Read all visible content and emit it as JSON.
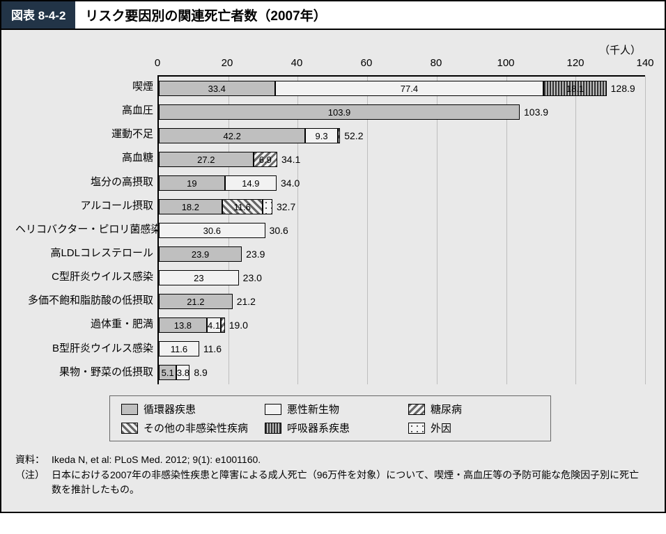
{
  "header": {
    "fig_no": "図表 8-4-2",
    "title": "リスク要因別の関連死亡者数（2007年）"
  },
  "unit_label": "（千人）",
  "source_label": "資料：",
  "source_text": "Ikeda N, et al: PLoS Med. 2012; 9(1): e1001160.",
  "note_label": "（注）",
  "note_text": "日本における2007年の非感染性疾患と障害による成人死亡（96万件を対象）について、喫煙・高血圧等の予防可能な危険因子別に死亡数を推計したもの。",
  "legend": {
    "cardio": "循環器疾患",
    "cancer": "悪性新生物",
    "diabetes": "糖尿病",
    "ncd": "その他の非感染性疾病",
    "resp": "呼吸器系疾患",
    "ext": "外因"
  },
  "chart_data": {
    "type": "bar",
    "orientation": "horizontal",
    "stacked": true,
    "xlabel": "",
    "ylabel": "",
    "xlim": [
      0,
      140
    ],
    "xticks": [
      0,
      20,
      40,
      60,
      80,
      100,
      120,
      140
    ],
    "series_labels": {
      "cardio": "循環器疾患",
      "cancer": "悪性新生物",
      "diabetes": "糖尿病",
      "ncd": "その他の非感染性疾病",
      "resp": "呼吸器系疾患",
      "ext": "外因"
    },
    "rows": [
      {
        "label": "喫煙",
        "segments": [
          {
            "k": "cardio",
            "v": 33.4
          },
          {
            "k": "cancer",
            "v": 77.4
          },
          {
            "k": "resp",
            "v": 18.1
          }
        ],
        "total": 128.9
      },
      {
        "label": "高血圧",
        "segments": [
          {
            "k": "cardio",
            "v": 103.9
          }
        ],
        "total": 103.9
      },
      {
        "label": "運動不足",
        "segments": [
          {
            "k": "cardio",
            "v": 42.2
          },
          {
            "k": "cancer",
            "v": 9.3
          },
          {
            "k": "diabetes",
            "v": 0.7,
            "hide_label": true
          }
        ],
        "total": 52.2
      },
      {
        "label": "高血糖",
        "segments": [
          {
            "k": "cardio",
            "v": 27.2
          },
          {
            "k": "diabetes",
            "v": 6.9
          }
        ],
        "total": 34.1
      },
      {
        "label": "塩分の高摂取",
        "segments": [
          {
            "k": "cardio",
            "v": 19
          },
          {
            "k": "cancer",
            "v": 14.9
          }
        ],
        "total": 34.0,
        "total_text": "34.0"
      },
      {
        "label": "アルコール摂取",
        "segments": [
          {
            "k": "cardio",
            "v": 18.2
          },
          {
            "k": "ncd",
            "v": 11.6
          },
          {
            "k": "ext",
            "v": 2.9,
            "hide_label": true
          }
        ],
        "total": 32.7
      },
      {
        "label": "ヘリコバクター・ピロリ菌感染",
        "segments": [
          {
            "k": "cancer",
            "v": 30.6
          }
        ],
        "total": 30.6
      },
      {
        "label": "高LDLコレステロール",
        "segments": [
          {
            "k": "cardio",
            "v": 23.9
          }
        ],
        "total": 23.9
      },
      {
        "label": "C型肝炎ウイルス感染",
        "segments": [
          {
            "k": "cancer",
            "v": 23
          }
        ],
        "total": 23.0,
        "total_text": "23.0"
      },
      {
        "label": "多価不飽和脂肪酸の低摂取",
        "segments": [
          {
            "k": "cardio",
            "v": 21.2
          }
        ],
        "total": 21.2
      },
      {
        "label": "過体重・肥満",
        "segments": [
          {
            "k": "cardio",
            "v": 13.8
          },
          {
            "k": "cancer",
            "v": 4.1
          },
          {
            "k": "diabetes",
            "v": 1.1,
            "hide_label": true
          }
        ],
        "total": 19.0,
        "total_text": "19.0"
      },
      {
        "label": "B型肝炎ウイルス感染",
        "segments": [
          {
            "k": "cancer",
            "v": 11.6
          }
        ],
        "total": 11.6
      },
      {
        "label": "果物・野菜の低摂取",
        "segments": [
          {
            "k": "cardio",
            "v": 5.1
          },
          {
            "k": "cancer",
            "v": 3.8
          }
        ],
        "total": 8.9
      }
    ]
  }
}
